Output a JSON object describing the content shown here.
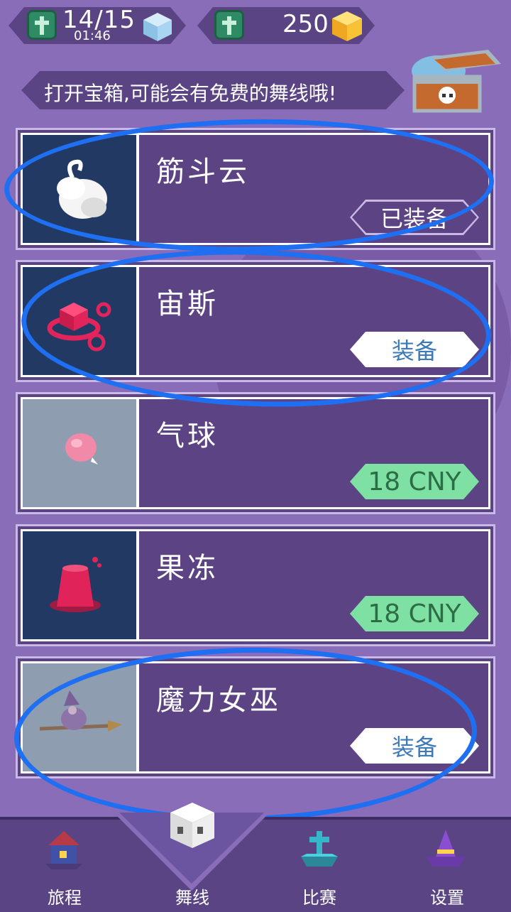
{
  "status": {
    "lives": "14/15",
    "timer": "01:46",
    "coins": "250",
    "icons": [
      "grave-cross-icon",
      "blue-cube-icon",
      "grave-cross-icon",
      "gold-cube-icon"
    ]
  },
  "banner": {
    "text": "打开宝箱,可能会有免费的舞线哦!",
    "icon": "treasure-chest-icon"
  },
  "items": [
    {
      "name": "筋斗云",
      "action": "已装备",
      "state": "equipped",
      "icon": "cloud-icon"
    },
    {
      "name": "宙斯",
      "action": "装备",
      "state": "owned",
      "icon": "zeus-cube-icon"
    },
    {
      "name": "气球",
      "action": "18 CNY",
      "state": "price",
      "icon": "balloon-icon"
    },
    {
      "name": "果冻",
      "action": "18 CNY",
      "state": "price",
      "icon": "jelly-icon"
    },
    {
      "name": "魔力女巫",
      "action": "装备",
      "state": "owned",
      "icon": "witch-icon"
    }
  ],
  "nav": [
    {
      "label": "旅程",
      "icon": "house-icon"
    },
    {
      "label": "舞线",
      "icon": "skull-icon",
      "active": true
    },
    {
      "label": "比赛",
      "icon": "tombstone-icon"
    },
    {
      "label": "设置",
      "icon": "wizard-hat-icon"
    }
  ],
  "colors": {
    "background": "#8a6db8",
    "panel": "#5c4484",
    "price_tag": "#7fe0a3",
    "equip_text": "#3e79b9",
    "marker": "#1e6ff2"
  }
}
